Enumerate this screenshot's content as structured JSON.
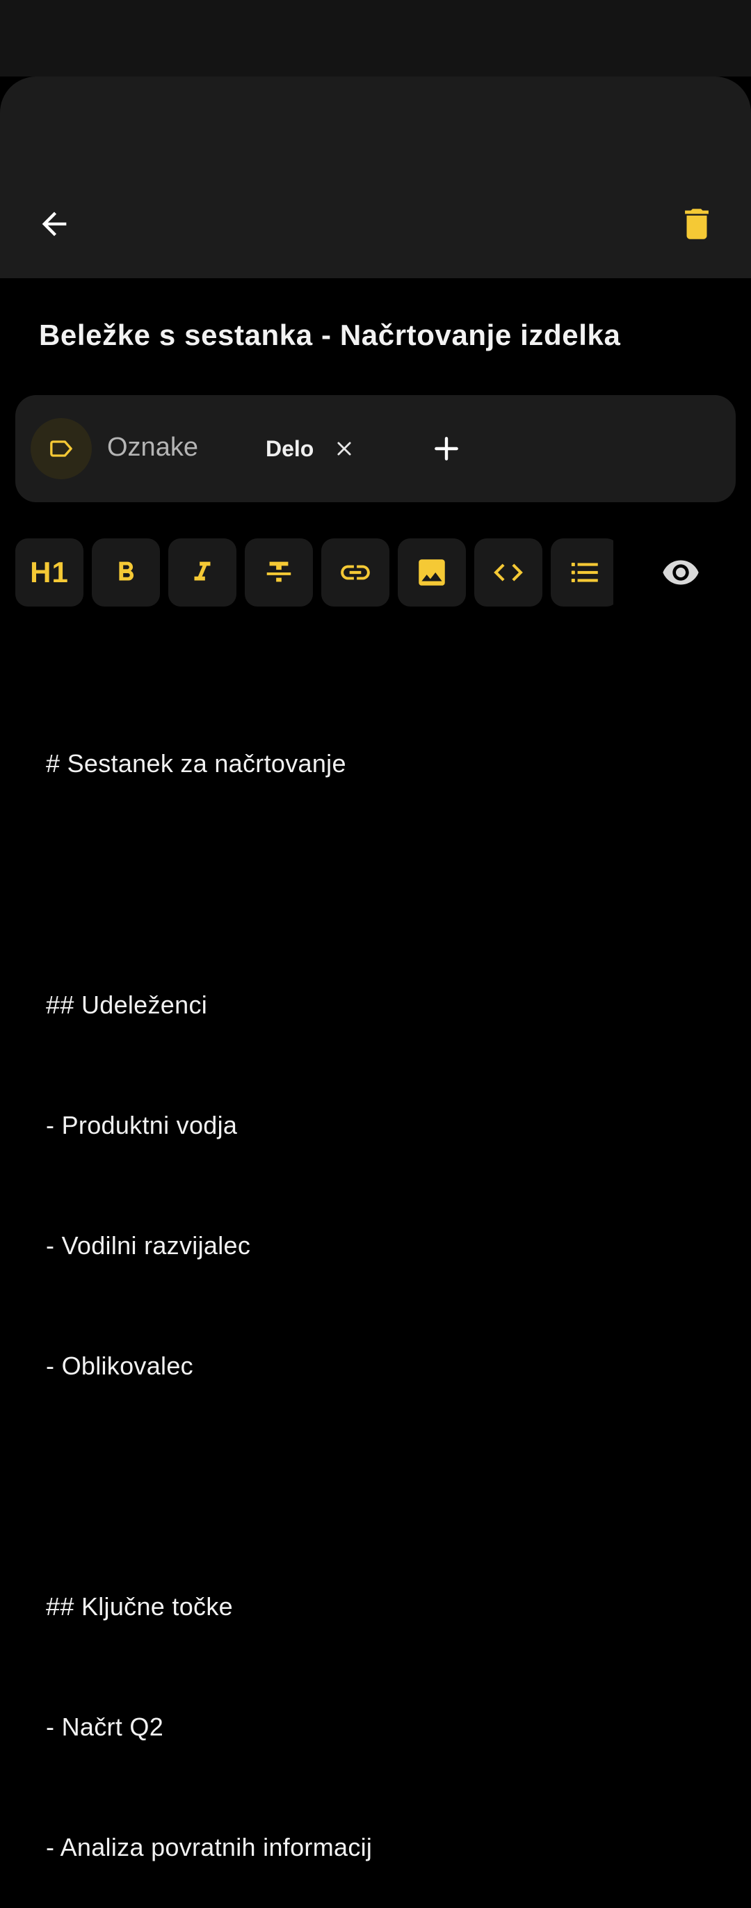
{
  "header": {
    "back_icon": "arrow-left-icon",
    "delete_icon": "trash-icon"
  },
  "note": {
    "title": "Beležke s sestanka - Načrtovanje izdelka"
  },
  "tags": {
    "icon": "tag-icon",
    "label": "Oznake",
    "chips": [
      {
        "label": "Delo"
      }
    ],
    "add_icon": "plus-icon"
  },
  "toolbar": {
    "h1_label": "H1",
    "tools": [
      "h1",
      "bold-icon",
      "italic-icon",
      "strikethrough-icon",
      "link-icon",
      "image-icon",
      "code-icon",
      "list-icon"
    ],
    "preview_icon": "eye-icon"
  },
  "editor": {
    "lines": [
      "# Sestanek za načrtovanje",
      "",
      "## Udeleženci",
      "- Produktni vodja",
      "- Vodilni razvijalec",
      "- Oblikovalec",
      "",
      "## Ključne točke",
      "- Načrt Q2",
      "- Analiza povratnih informacij"
    ]
  },
  "colors": {
    "background": "#000000",
    "surface": "#1c1c1c",
    "accent": "#f5c935",
    "text": "#f2f2f2",
    "muted_text": "#b5b5b5"
  }
}
